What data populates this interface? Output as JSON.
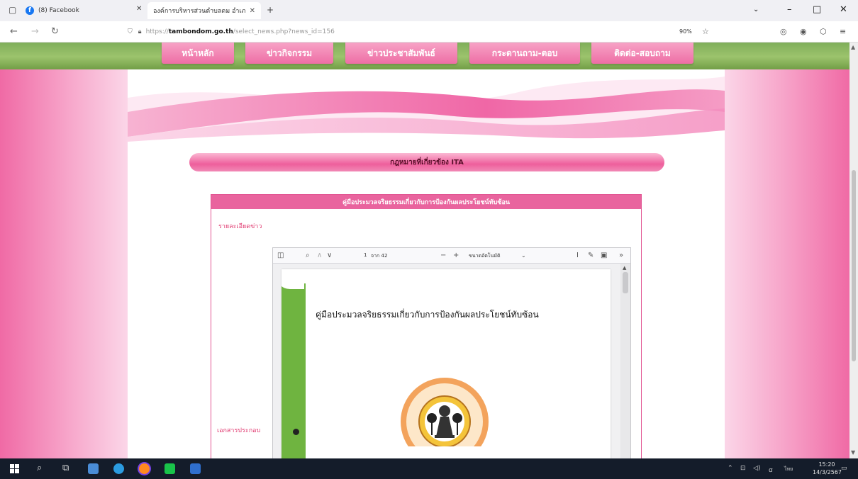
{
  "browser": {
    "tabs": [
      {
        "title": "(8) Facebook"
      },
      {
        "title": "องค์การบริหารส่วนตำบลดม อำเภอสั"
      }
    ],
    "new_tab_label": "+",
    "url": {
      "protocol": "https://",
      "domain": "tambondom.go.th",
      "path": "/select_news.php?news_id=156"
    },
    "zoom": "90%"
  },
  "site": {
    "menu": [
      {
        "label": "หน้าหลัก"
      },
      {
        "label": "ข่าวกิจกรรม"
      },
      {
        "label": "ข่าวประชาสัมพันธ์"
      },
      {
        "label": "กระดานถาม-ตอบ"
      },
      {
        "label": "ติดต่อ-สอบถาม"
      }
    ],
    "section_title": "กฎหมายที่เกี่ยวข้อง ITA",
    "news": {
      "header": "คู่มือประมวลจริยธรรมเกี่ยวกับการป้องกันผลประโยชน์ทับซ้อน",
      "detail_label": "รายละเอียดข่าว",
      "attachment_label": "เอกสารประกอบ"
    }
  },
  "pdf": {
    "page_current": "1",
    "page_total": "จาก 42",
    "zoom_option": "ขนาดอัตโนมัติ",
    "document_title": "คู่มือประมวลจริยธรรมเกี่ยวกับการป้องกันผลประโยชน์ทับซ้อน"
  },
  "taskbar": {
    "time": "15:20",
    "date": "14/3/2567",
    "lang": "ไทย"
  },
  "colors": {
    "pink_accent": "#e9649e",
    "green_spine": "#6fb440",
    "taskbar": "#141c2a"
  }
}
